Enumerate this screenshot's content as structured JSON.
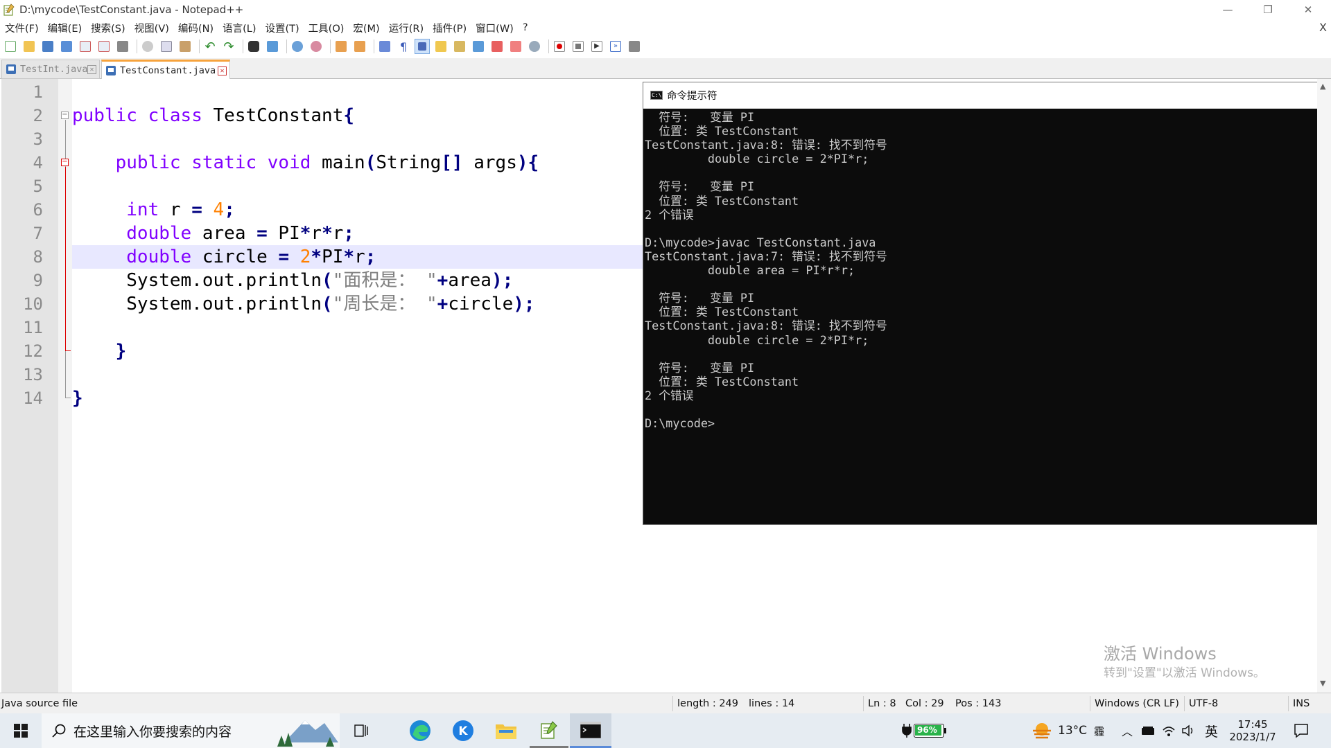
{
  "window": {
    "title": "D:\\mycode\\TestConstant.java - Notepad++",
    "min": "—",
    "max": "❐",
    "close": "✕"
  },
  "menu": [
    "文件(F)",
    "编辑(E)",
    "搜索(S)",
    "视图(V)",
    "编码(N)",
    "语言(L)",
    "设置(T)",
    "工具(O)",
    "宏(M)",
    "运行(R)",
    "插件(P)",
    "窗口(W)",
    "?"
  ],
  "menu_close": "X",
  "tabs": [
    {
      "label": "TestInt.java",
      "active": false,
      "close": "✕"
    },
    {
      "label": "TestConstant.java",
      "active": true,
      "close": "✕"
    }
  ],
  "editor": {
    "line_numbers": [
      "1",
      "2",
      "3",
      "4",
      "5",
      "6",
      "7",
      "8",
      "9",
      "10",
      "11",
      "12",
      "13",
      "14"
    ],
    "lines": [
      "",
      "public class TestConstant{",
      "",
      "    public static void main(String[] args){",
      "",
      "     int r = 4;",
      "     double area = PI*r*r;",
      "     double circle = 2*PI*r;",
      "     System.out.println(\"面积是： \"+area);",
      "     System.out.println(\"周长是： \"+circle);",
      "",
      "    }",
      "",
      "}"
    ],
    "current_line": 8
  },
  "cmd": {
    "title": "命令提示符",
    "icon_text": "C:\\",
    "output": "  符号:   变量 PI\n  位置: 类 TestConstant\nTestConstant.java:8: 错误: 找不到符号\n         double circle = 2*PI*r;\n\n  符号:   变量 PI\n  位置: 类 TestConstant\n2 个错误\n\nD:\\mycode>javac TestConstant.java\nTestConstant.java:7: 错误: 找不到符号\n         double area = PI*r*r;\n\n  符号:   变量 PI\n  位置: 类 TestConstant\nTestConstant.java:8: 错误: 找不到符号\n         double circle = 2*PI*r;\n\n  符号:   变量 PI\n  位置: 类 TestConstant\n2 个错误\n\nD:\\mycode>"
  },
  "status": {
    "file_type": "Java source file",
    "length": "length : 249",
    "lines": "lines : 14",
    "ln": "Ln : 8",
    "col": "Col : 29",
    "pos": "Pos : 143",
    "eol": "Windows (CR LF)",
    "encoding": "UTF-8",
    "mode": "INS"
  },
  "watermark": {
    "line1": "激活 Windows",
    "line2": "转到\"设置\"以激活 Windows。"
  },
  "taskbar": {
    "search_placeholder": "在这里输入你要搜索的内容",
    "battery": "96%",
    "temperature": "13°C",
    "weather_label": "霾",
    "ime": "英",
    "time": "17:45",
    "date": "2023/1/7"
  },
  "colors": {
    "keyword": "#8000ff",
    "number": "#ff8000",
    "operator": "#000080",
    "string": "#808080",
    "active_tab_accent": "#f7a33c",
    "cmd_background": "#0c0c0c",
    "cmd_text": "#cccccc"
  },
  "icons": {
    "toolbar": [
      "new-file-icon",
      "open-file-icon",
      "save-icon",
      "save-all-icon",
      "close-icon",
      "close-all-icon",
      "print-icon",
      "cut-icon",
      "copy-icon",
      "paste-icon",
      "undo-icon",
      "redo-icon",
      "find-icon",
      "replace-icon",
      "zoom-in-icon",
      "zoom-out-icon",
      "sync-v-icon",
      "sync-h-icon",
      "word-wrap-icon",
      "show-all-chars-icon",
      "indent-guide-icon",
      "doc-map-icon",
      "function-list-icon",
      "folder-workspace-icon",
      "monitoring-icon",
      "record-macro-icon",
      "stop-macro-icon",
      "play-macro-icon",
      "run-macro-multiple-icon",
      "save-macro-icon"
    ]
  }
}
